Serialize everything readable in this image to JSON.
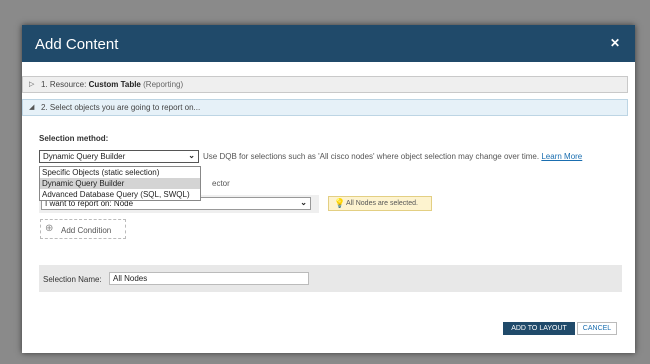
{
  "dialog": {
    "title": "Add Content",
    "close_glyph": "✕"
  },
  "sections": [
    {
      "arrow": "▷",
      "prefix": "1. Resource: ",
      "name": "Custom Table",
      "sub": "(Reporting)"
    },
    {
      "arrow": "◢",
      "label": "2. Select objects you are going to report on..."
    }
  ],
  "selection": {
    "label": "Selection method:",
    "current_value": "Dynamic Query Builder",
    "hint": "Use DQB for selections such as 'All cisco nodes' where object selection may change over time.",
    "learn_more": "Learn More",
    "options": [
      "Specific Objects (static selection)",
      "Dynamic Query Builder",
      "Advanced Database Query (SQL, SWQL)"
    ],
    "selected_index": 1,
    "partial_text": "ector"
  },
  "report_on": {
    "value": "I want to report on:  Node",
    "notice": "All Nodes are selected.",
    "notice_icon": "lightbulb-icon"
  },
  "add_condition": {
    "label": "Add Condition",
    "icon": "plus-circle-icon"
  },
  "selection_name": {
    "label": "Selection Name:",
    "value": "All Nodes"
  },
  "buttons": {
    "add": "ADD TO LAYOUT",
    "cancel": "CANCEL"
  },
  "colors": {
    "titlebar": "#204a6a",
    "accent_link": "#1a6eb0",
    "notice_bg": "#fdf3cf",
    "section_active_bg": "#e6f1f8"
  }
}
